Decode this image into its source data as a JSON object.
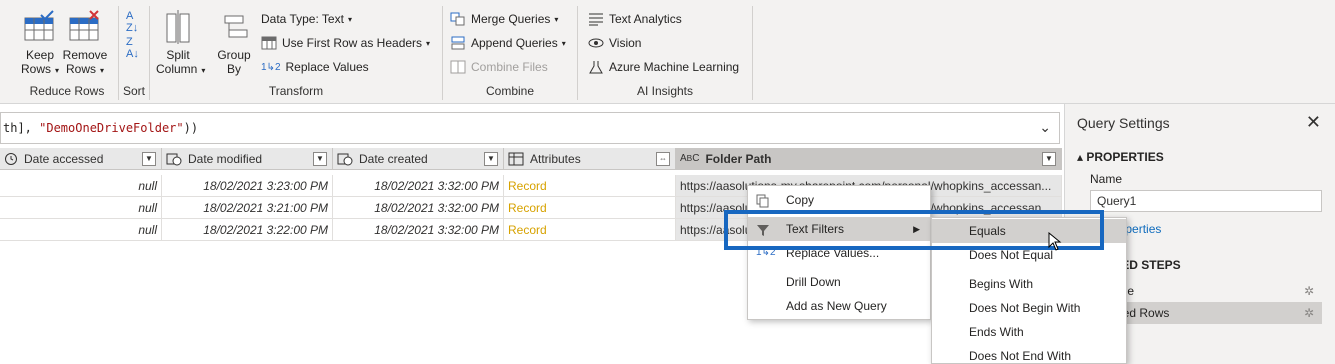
{
  "ribbon": {
    "reduce_rows": {
      "keep_rows": "Keep Rows",
      "remove_rows": "Remove Rows",
      "group_label": "Reduce Rows"
    },
    "sort": {
      "group_label": "Sort"
    },
    "transform": {
      "split_column": "Split Column",
      "group_by": "Group By",
      "data_type": "Data Type: Text",
      "use_first_row": "Use First Row as Headers",
      "replace_values": "Replace Values",
      "group_label": "Transform"
    },
    "combine": {
      "merge_queries": "Merge Queries",
      "append_queries": "Append Queries",
      "combine_files": "Combine Files",
      "group_label": "Combine"
    },
    "ai_insights": {
      "text_analytics": "Text Analytics",
      "vision": "Vision",
      "azure_ml": "Azure Machine Learning",
      "group_label": "AI Insights"
    }
  },
  "formula": {
    "prefix": "th], ",
    "string": "\"DemoOneDriveFolder\"",
    "suffix": "))"
  },
  "grid": {
    "headers": [
      "Date accessed",
      "Date modified",
      "Date created",
      "Attributes",
      "Folder Path"
    ],
    "rows": [
      {
        "accessed": "null",
        "modified": "18/02/2021 3:23:00 PM",
        "created": "18/02/2021 3:32:00 PM",
        "attributes": "Record",
        "path": "https://aasolutions-my.sharepoint.com/personal/whopkins_accessan..."
      },
      {
        "accessed": "null",
        "modified": "18/02/2021 3:21:00 PM",
        "created": "18/02/2021 3:32:00 PM",
        "attributes": "Record",
        "path": "https://aasolutions-my.sharepoint.com/personal/whopkins_accessan..."
      },
      {
        "accessed": "null",
        "modified": "18/02/2021 3:22:00 PM",
        "created": "18/02/2021 3:32:00 PM",
        "attributes": "Record",
        "path": "https://aasolutions-my.sharepoint.com/personal/whopkins_accessan..."
      }
    ]
  },
  "query_settings": {
    "title": "Query Settings",
    "properties_heading": "PROPERTIES",
    "name_label": "Name",
    "name_value": "Query1",
    "all_properties": "All Properties",
    "applied_steps_heading": "APPLIED STEPS",
    "steps": [
      "Source",
      "Filtered Rows"
    ]
  },
  "context_menu": {
    "items": [
      "Copy",
      "Text Filters",
      "Replace Values...",
      "Drill Down",
      "Add as New Query"
    ]
  },
  "submenu": {
    "items": [
      "Equals",
      "Does Not Equal",
      "Begins With",
      "Does Not Begin With",
      "Ends With",
      "Does Not End With"
    ]
  },
  "colors": {
    "accent": "#1767c0",
    "record": "#d7a200",
    "ribbon_bg": "#f3f2f1"
  }
}
